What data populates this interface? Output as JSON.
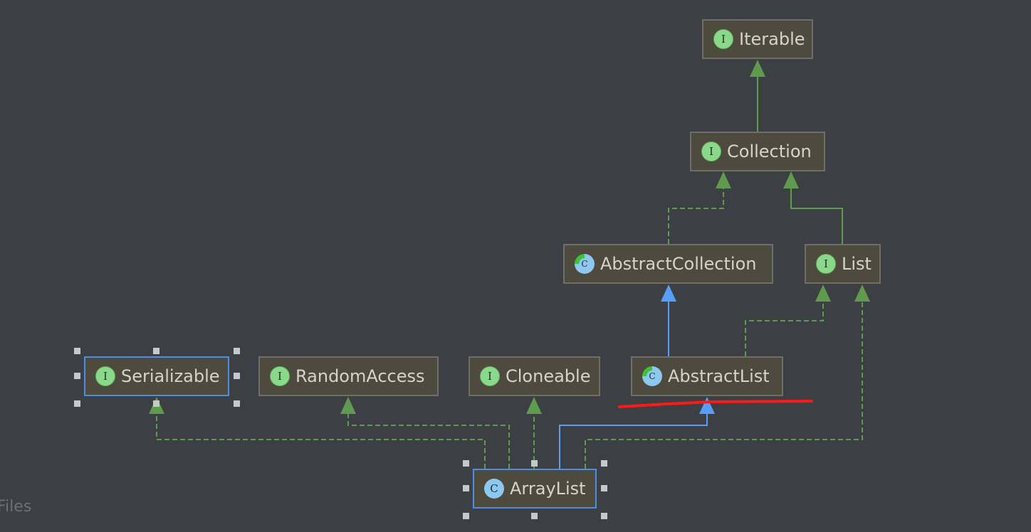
{
  "nodes": [
    {
      "id": "iterable",
      "label": "Iterable",
      "kind": "interface",
      "icon": "I"
    },
    {
      "id": "collection",
      "label": "Collection",
      "kind": "interface",
      "icon": "I"
    },
    {
      "id": "abstract-collection",
      "label": "AbstractCollection",
      "kind": "abstract-class",
      "icon": "C"
    },
    {
      "id": "list",
      "label": "List",
      "kind": "interface",
      "icon": "I"
    },
    {
      "id": "serializable",
      "label": "Serializable",
      "kind": "interface",
      "icon": "I",
      "selected": true
    },
    {
      "id": "random-access",
      "label": "RandomAccess",
      "kind": "interface",
      "icon": "I"
    },
    {
      "id": "cloneable",
      "label": "Cloneable",
      "kind": "interface",
      "icon": "I"
    },
    {
      "id": "abstract-list",
      "label": "AbstractList",
      "kind": "abstract-class",
      "icon": "C"
    },
    {
      "id": "array-list",
      "label": "ArrayList",
      "kind": "class",
      "icon": "C",
      "selected": true
    }
  ],
  "edges": [
    {
      "from": "Collection",
      "to": "Iterable",
      "type": "extends"
    },
    {
      "from": "AbstractCollection",
      "to": "Collection",
      "type": "implements"
    },
    {
      "from": "List",
      "to": "Collection",
      "type": "extends"
    },
    {
      "from": "AbstractList",
      "to": "AbstractCollection",
      "type": "extends-class"
    },
    {
      "from": "AbstractList",
      "to": "List",
      "type": "implements"
    },
    {
      "from": "ArrayList",
      "to": "Serializable",
      "type": "implements"
    },
    {
      "from": "ArrayList",
      "to": "RandomAccess",
      "type": "implements"
    },
    {
      "from": "ArrayList",
      "to": "Cloneable",
      "type": "implements"
    },
    {
      "from": "ArrayList",
      "to": "AbstractList",
      "type": "extends-class"
    },
    {
      "from": "ArrayList",
      "to": "List",
      "type": "implements"
    }
  ],
  "colors": {
    "background": "#3c3f43",
    "interface_edge": "#5f9a4f",
    "class_edge": "#589df6",
    "annotation": "#ff1a1a",
    "selection": "#4e8ee6"
  },
  "footer": {
    "partial_label": "Files"
  }
}
